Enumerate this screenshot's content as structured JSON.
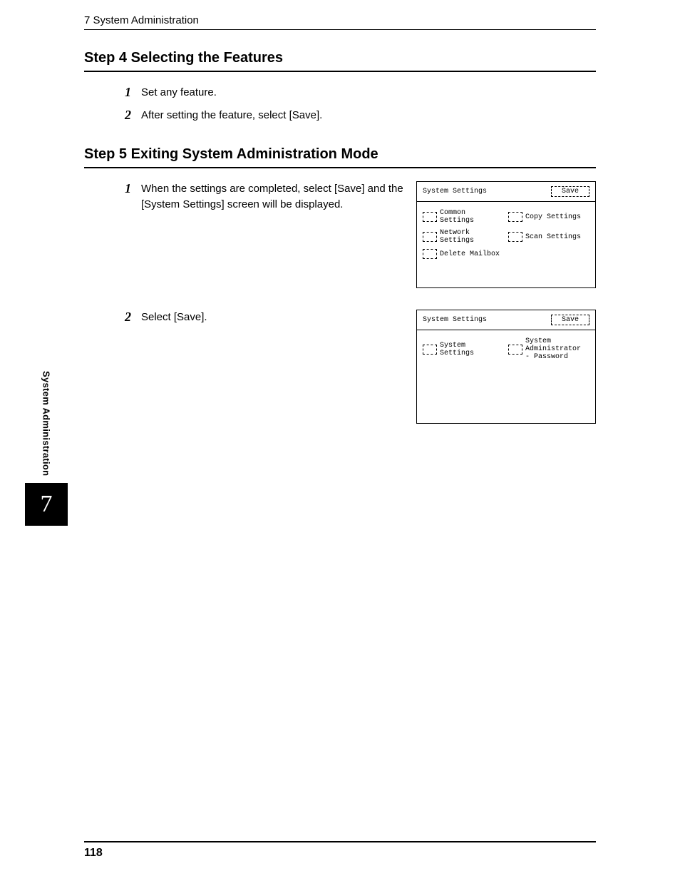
{
  "running_head": "7 System Administration",
  "section4": {
    "title": "Step 4 Selecting the Features",
    "steps": [
      {
        "num": "1",
        "text": "Set any feature."
      },
      {
        "num": "2",
        "text": "After setting the feature, select [Save]."
      }
    ]
  },
  "section5": {
    "title": "Step 5 Exiting System Administration Mode",
    "steps": [
      {
        "num": "1",
        "text": "When the settings are completed, select [Save] and the [System Settings] screen will be displayed."
      },
      {
        "num": "2",
        "text": "Select [Save]."
      }
    ]
  },
  "panel1": {
    "title": "System Settings",
    "save": "Save",
    "opts": {
      "common": "Common Settings",
      "copy": "Copy Settings",
      "network": "Network Settings",
      "scan": "Scan Settings",
      "delete": "Delete Mailbox"
    }
  },
  "panel2": {
    "title": "System Settings",
    "save": "Save",
    "opts": {
      "system": "System Settings",
      "admin": "System Administrator - Password"
    }
  },
  "side": {
    "text": "System Administration",
    "num": "7"
  },
  "page_number": "118"
}
